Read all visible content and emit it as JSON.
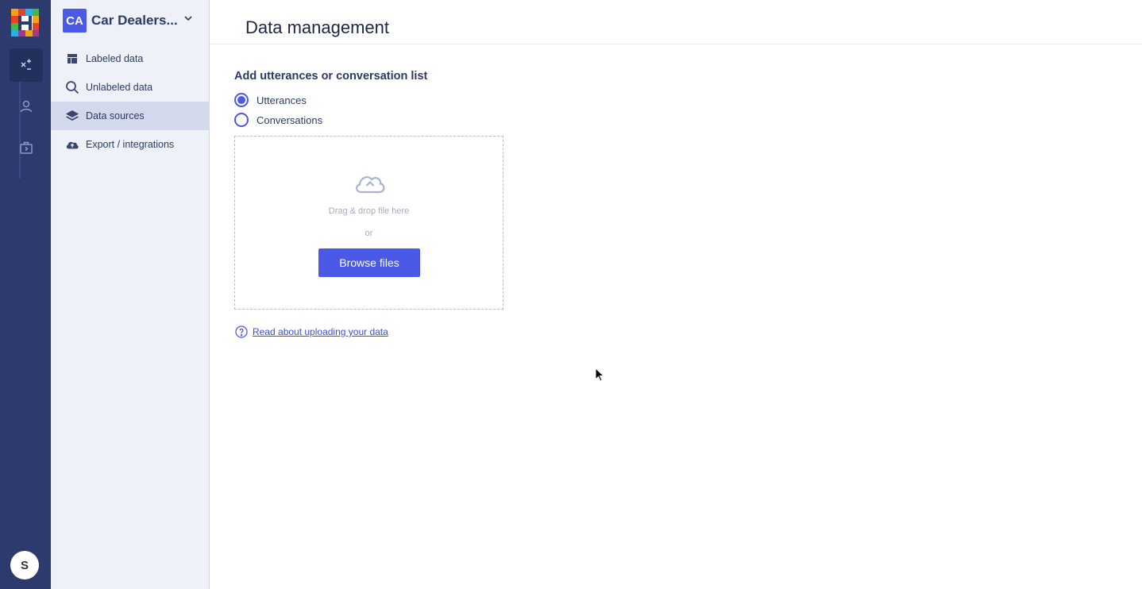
{
  "app": {
    "logo_name": "hellohive-logo",
    "rail_icons": [
      "automation-icon",
      "user-icon",
      "briefcase-icon"
    ],
    "user_avatar_initial": "S"
  },
  "project": {
    "initials": "CA",
    "name": "Car Dealers..."
  },
  "sidebar": {
    "items": [
      {
        "label": "Labeled data",
        "icon": "labeled-data-icon",
        "active": false
      },
      {
        "label": "Unlabeled data",
        "icon": "search-icon",
        "active": false
      },
      {
        "label": "Data sources",
        "icon": "layers-icon",
        "active": true
      },
      {
        "label": "Export / integrations",
        "icon": "cloud-upload-icon",
        "active": false
      }
    ]
  },
  "main": {
    "title": "Data management",
    "section_title": "Add utterances or conversation list",
    "options": [
      {
        "label": "Utterances",
        "selected": true
      },
      {
        "label": "Conversations",
        "selected": false
      }
    ],
    "dropzone": {
      "drag_text": "Drag & drop file here",
      "or_text": "or",
      "browse_label": "Browse files"
    },
    "help_link": "Read about uploading your data"
  },
  "colors": {
    "rail": "#2c3a6e",
    "sidebar": "#eef1f8",
    "accent": "#4b5ae6",
    "text": "#2b3a67"
  }
}
